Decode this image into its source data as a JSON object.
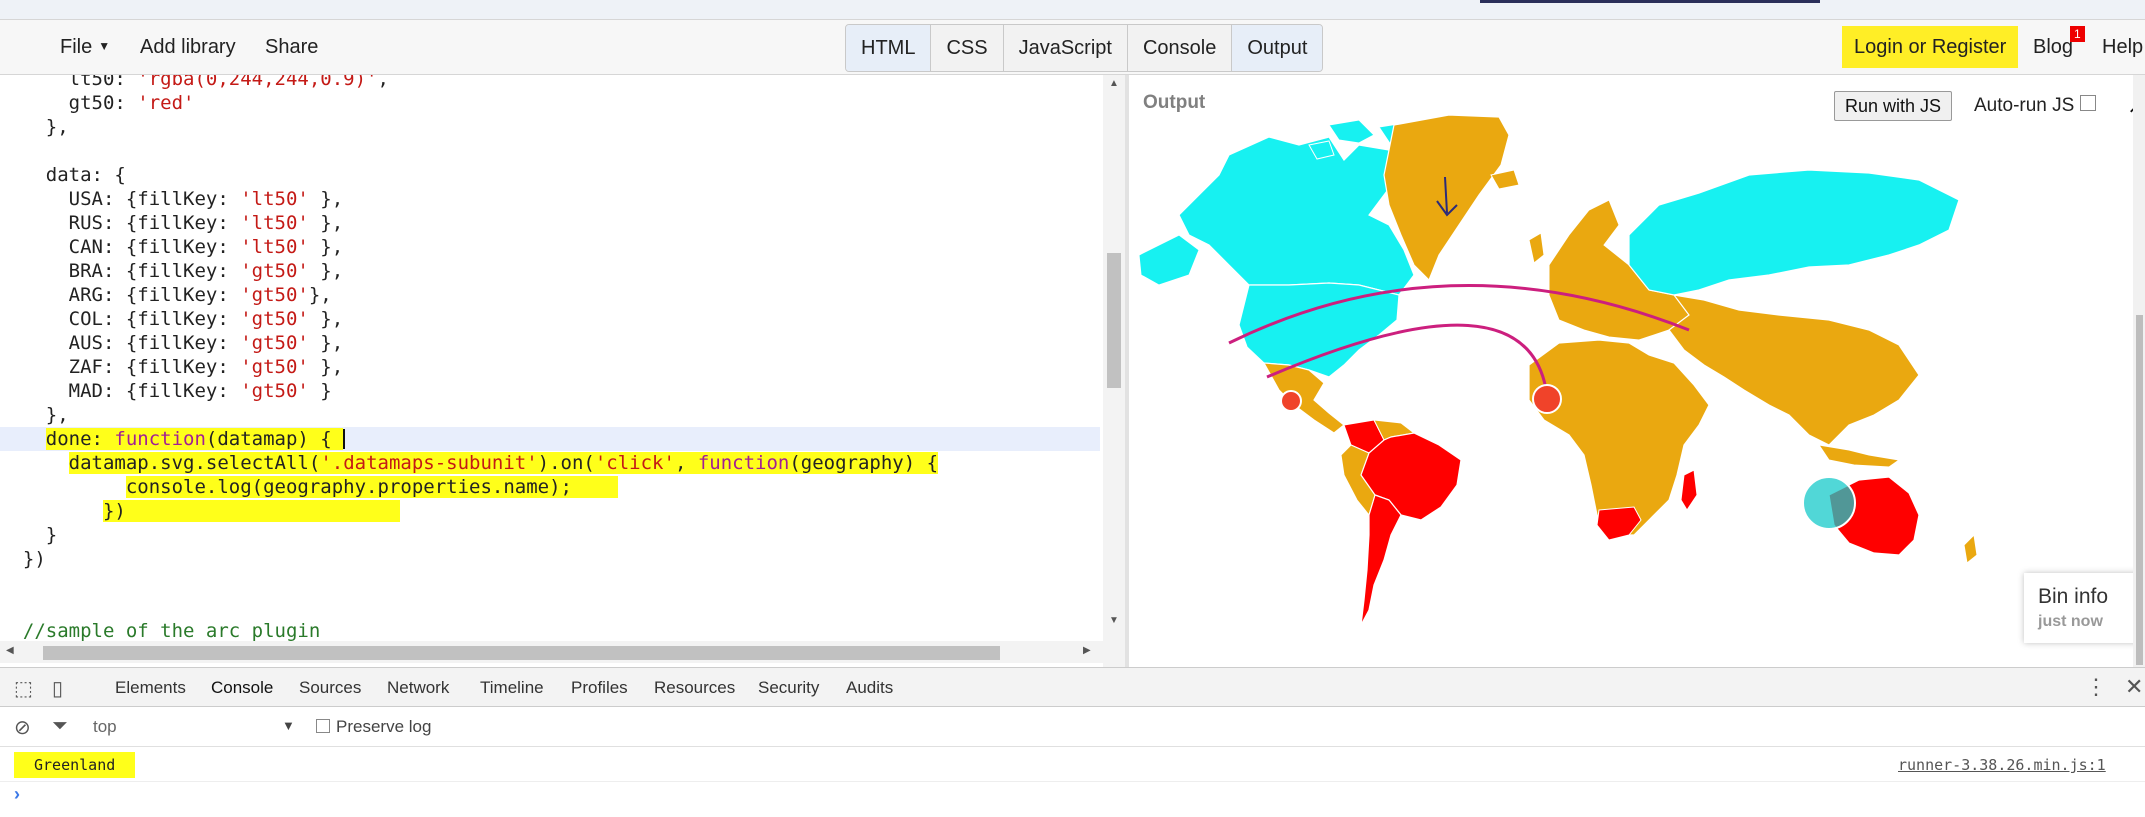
{
  "toolbar": {
    "file": "File",
    "add_library": "Add library",
    "share": "Share",
    "tabs": [
      "HTML",
      "CSS",
      "JavaScript",
      "Console",
      "Output"
    ],
    "login": "Login or Register",
    "blog": "Blog",
    "blog_badge": "1",
    "help": "Help"
  },
  "editor": {
    "lines": [
      "      lt50: 'rgba(0,244,244,0.9)',",
      "      gt50: 'red'",
      "    },",
      "",
      "    data: {",
      "      USA: {fillKey: 'lt50' },",
      "      RUS: {fillKey: 'lt50' },",
      "      CAN: {fillKey: 'lt50' },",
      "      BRA: {fillKey: 'gt50' },",
      "      ARG: {fillKey: 'gt50'},",
      "      COL: {fillKey: 'gt50' },",
      "      AUS: {fillKey: 'gt50' },",
      "      ZAF: {fillKey: 'gt50' },",
      "      MAD: {fillKey: 'gt50' }",
      "    },",
      "    done: function(datamap) {",
      "      datamap.svg.selectAll('.datamaps-subunit').on('click', function(geography) {",
      "           console.log(geography.properties.name);",
      "         })",
      "    }",
      "  })",
      "",
      "",
      "  //sample of the arc plugin"
    ]
  },
  "output": {
    "title": "Output",
    "run_button": "Run with JS",
    "autorun": "Auto-run JS",
    "bin_info_title": "Bin info",
    "bin_info_time": "just now",
    "colors": {
      "lt50": "#17f1f1",
      "gt50": "#ff0000",
      "default": "#eaa810",
      "arc": "#cc1f7e",
      "bubble": "#f0432a"
    }
  },
  "devtools": {
    "tabs": [
      "Elements",
      "Console",
      "Sources",
      "Network",
      "Timeline",
      "Profiles",
      "Resources",
      "Security",
      "Audits"
    ],
    "context": "top",
    "preserve_log": "Preserve log",
    "log_message": "Greenland",
    "log_source": "runner-3.38.26.min.js:1"
  }
}
